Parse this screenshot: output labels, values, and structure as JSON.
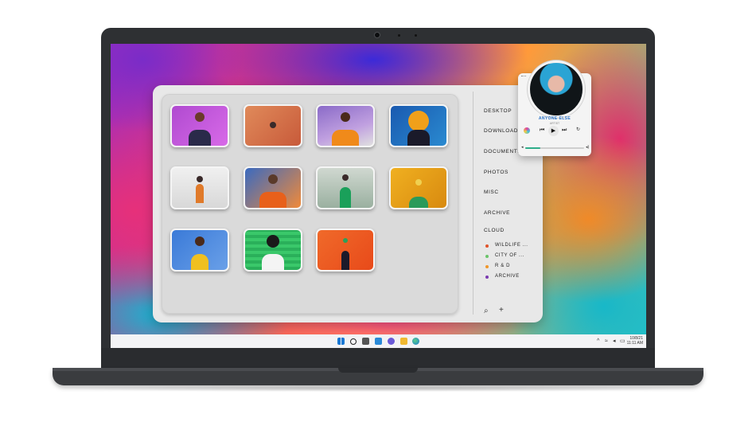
{
  "explorer": {
    "nav_items": [
      "DESKTOP",
      "DOWNLOADS",
      "DOCUMENTS",
      "PHOTOS",
      "MISC",
      "ARCHIVE",
      "CLOUD"
    ],
    "cloud_items": [
      {
        "label": "WILDLIFE ...",
        "color": "#e0542a"
      },
      {
        "label": "CITY OF ...",
        "color": "#6ac46a"
      },
      {
        "label": "R & D",
        "color": "#f0962a"
      },
      {
        "label": "ARCHIVE",
        "color": "#7a3ab0"
      }
    ],
    "thumbnail_count": 11
  },
  "music": {
    "song": "ANYONE ELSE",
    "artist": "ARTIST",
    "progress": 0.25
  },
  "taskbar": {
    "date": "10/8/21",
    "time": "11:11 AM",
    "icons": [
      "windows-icon",
      "search-icon",
      "task-view-icon",
      "widgets-icon",
      "chat-icon",
      "file-explorer-icon",
      "edge-icon"
    ]
  },
  "colors": {
    "accent": "#2a72c8",
    "progress": "#2fae8a"
  }
}
